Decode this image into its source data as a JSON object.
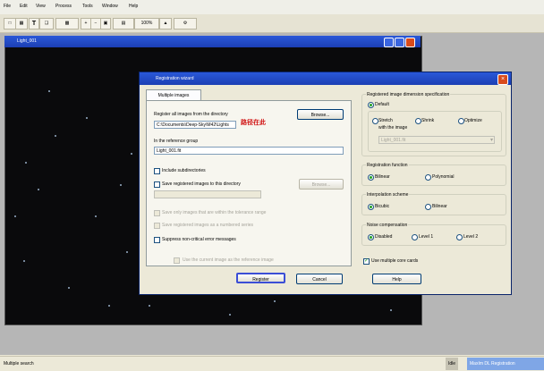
{
  "app": {
    "menu": [
      "File",
      "Edit",
      "View",
      "Process",
      "Tools",
      "Window",
      "Help"
    ]
  },
  "toolbar": {
    "zoom": "100%"
  },
  "image_window": {
    "title": "Light_001"
  },
  "dialog": {
    "title": "Registration wizard",
    "tab": "Multiple images",
    "register_label": "Register all images from the directory",
    "browse": "Browse...",
    "directory_value": "C:\\Documents\\Deep-Sky\\M42\\Lights",
    "annotation": "路径在此",
    "reference_label": "In the reference group",
    "reference_value": "Light_001.fit",
    "include_sub": "Include subdirectories",
    "save_label": "Save registered images to this directory",
    "browse2": "Browse...",
    "save_value": "",
    "opt_a": "Save only images that are within the tolerance range",
    "opt_b": "Save registered images as a numbered series",
    "suppress": "Suppress non-critical error messages",
    "bottom_check": "Use the current image as the reference image",
    "register_btn": "Register",
    "cancel_btn": "Cancel",
    "help_btn": "Help",
    "params_group": "Registered image dimension specification",
    "p_default": "Default",
    "p_stretch": "Stretch",
    "p_shrink": "Shrink",
    "p_optimize": "Optimize",
    "p_with": "with the image",
    "p_combo": "Light_001.fit",
    "func_group": "Registration function",
    "f_bilinear": "Bilinear",
    "f_polynomial": "Polynomial",
    "interp_group": "Interpolation scheme",
    "i_bicubic": "Bicubic",
    "i_bilinear": "Bilinear",
    "noise_group": "Noise compensation",
    "n_disabled": "Disabled",
    "n_level1": "Level 1",
    "n_level2": "Level 2",
    "multi_core": "Use multiple core cards"
  },
  "status": {
    "left": "Multiple search",
    "right_a": "Idle",
    "right_b": "MaxIm DL Registration"
  }
}
